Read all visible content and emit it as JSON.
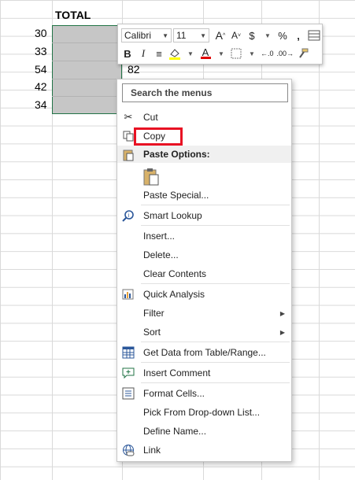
{
  "sheet": {
    "header": "TOTAL",
    "values": [
      "30",
      "33",
      "54",
      "42",
      "34"
    ],
    "visible_value": "82"
  },
  "mini_toolbar": {
    "font_name": "Calibri",
    "font_size": "11",
    "grow_font": "A",
    "shrink_font": "A",
    "currency": "$",
    "percent": "%",
    "comma": ",",
    "bold": "B",
    "italic": "I",
    "font_color_letter": "A",
    "accent_fill": "#ffff00",
    "accent_font": "#e00000"
  },
  "context_menu": {
    "search_placeholder": "Search the menus",
    "items": {
      "cut": "Cut",
      "copy": "Copy",
      "paste_options": "Paste Options:",
      "paste_special": "Paste Special...",
      "smart_lookup": "Smart Lookup",
      "insert": "Insert...",
      "delete": "Delete...",
      "clear_contents": "Clear Contents",
      "quick_analysis": "Quick Analysis",
      "filter": "Filter",
      "sort": "Sort",
      "get_data": "Get Data from Table/Range...",
      "insert_comment": "Insert Comment",
      "format_cells": "Format Cells...",
      "pick_dropdown": "Pick From Drop-down List...",
      "define_name": "Define Name...",
      "link": "Link"
    },
    "highlight_color": "#e81123"
  }
}
